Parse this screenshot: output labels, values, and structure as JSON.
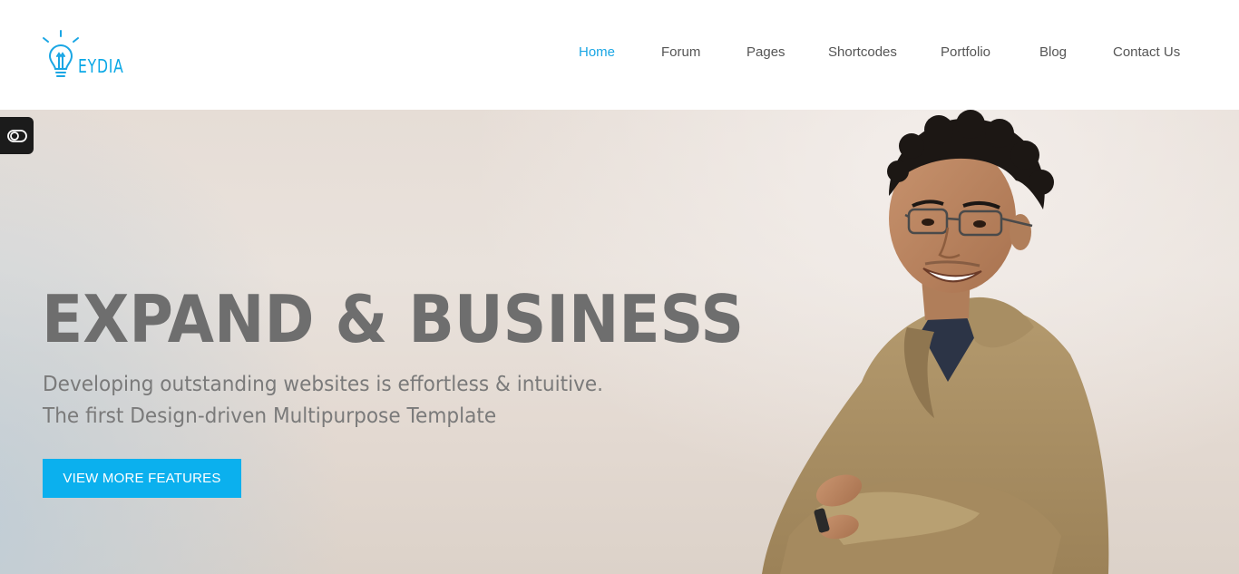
{
  "brand": {
    "logo_text": "EYDIA",
    "accent": "#1aa6e4"
  },
  "nav": {
    "items": [
      {
        "label": "Home",
        "active": true
      },
      {
        "label": "Forum",
        "active": false
      },
      {
        "label": "Pages",
        "active": false
      },
      {
        "label": "Shortcodes",
        "active": false
      },
      {
        "label": "Portfolio",
        "active": false
      },
      {
        "label": "Blog",
        "active": false
      },
      {
        "label": "Contact Us",
        "active": false
      }
    ]
  },
  "hero": {
    "headline": "EXPAND & BUSINESS",
    "subtitle_line1": "Developing outstanding websites is effortless & intuitive.",
    "subtitle_line2": "The first Design-driven Multipurpose Template",
    "cta_label": "VIEW MORE FEATURES",
    "cta_color": "#0bb0ee",
    "person_image": "smiling-man-with-glasses-crossed-arms"
  },
  "toggle": {
    "icon": "toggle-icon"
  }
}
